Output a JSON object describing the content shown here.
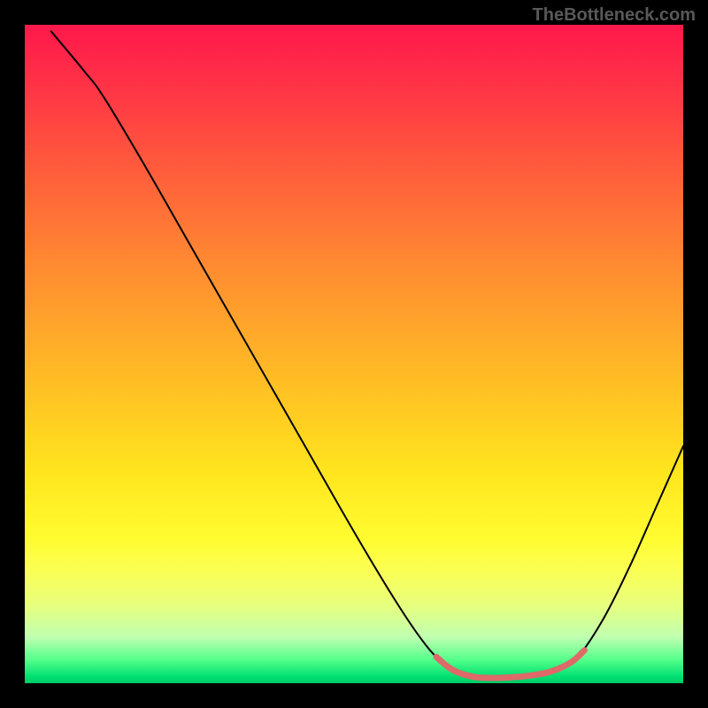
{
  "watermark": "TheBottleneck.com",
  "chart_data": {
    "type": "line",
    "title": "",
    "xlabel": "",
    "ylabel": "",
    "xlim": [
      0,
      100
    ],
    "ylim": [
      0,
      100
    ],
    "series": [
      {
        "name": "curve",
        "color": "#000000",
        "points": [
          {
            "x": 4,
            "y": 99
          },
          {
            "x": 9,
            "y": 93
          },
          {
            "x": 12,
            "y": 89
          },
          {
            "x": 18,
            "y": 79
          },
          {
            "x": 26,
            "y": 65
          },
          {
            "x": 34,
            "y": 51
          },
          {
            "x": 42,
            "y": 37
          },
          {
            "x": 50,
            "y": 23
          },
          {
            "x": 56,
            "y": 13
          },
          {
            "x": 60,
            "y": 7
          },
          {
            "x": 63,
            "y": 3.5
          },
          {
            "x": 66,
            "y": 1.5
          },
          {
            "x": 71,
            "y": 0.8
          },
          {
            "x": 76,
            "y": 1.0
          },
          {
            "x": 81,
            "y": 2
          },
          {
            "x": 84,
            "y": 4
          },
          {
            "x": 88,
            "y": 10
          },
          {
            "x": 92,
            "y": 18
          },
          {
            "x": 96,
            "y": 27
          },
          {
            "x": 100,
            "y": 36
          }
        ]
      },
      {
        "name": "highlight",
        "color": "#dd6a68",
        "points": [
          {
            "x": 62.5,
            "y": 4
          },
          {
            "x": 65,
            "y": 2
          },
          {
            "x": 68,
            "y": 1
          },
          {
            "x": 71,
            "y": 0.8
          },
          {
            "x": 74,
            "y": 0.9
          },
          {
            "x": 77,
            "y": 1.2
          },
          {
            "x": 80,
            "y": 1.8
          },
          {
            "x": 83,
            "y": 3.2
          },
          {
            "x": 85,
            "y": 5
          }
        ]
      }
    ]
  }
}
